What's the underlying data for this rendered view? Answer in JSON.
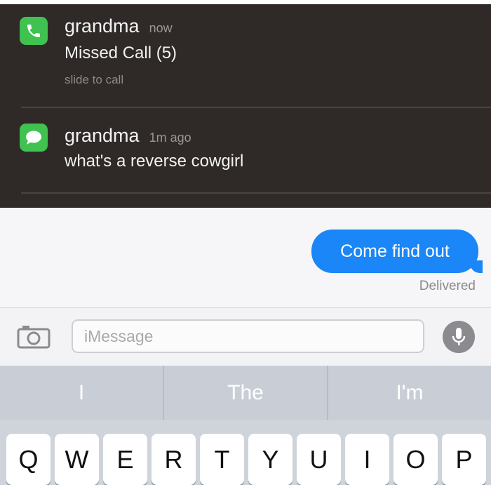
{
  "notifications": [
    {
      "icon": "phone-icon",
      "title": "grandma",
      "time": "now",
      "body": "Missed Call (5)",
      "sub": "slide to call"
    },
    {
      "icon": "message-icon",
      "title": "grandma",
      "time": "1m ago",
      "body": "what's a reverse cowgirl"
    }
  ],
  "conversation": {
    "outgoing_message": "Come find out",
    "status": "Delivered"
  },
  "input_bar": {
    "placeholder": "iMessage",
    "camera_icon": "camera-icon",
    "mic_icon": "microphone-icon"
  },
  "predictive": [
    "I",
    "The",
    "I'm"
  ],
  "keyboard": {
    "row1": [
      "Q",
      "W",
      "E",
      "R",
      "T",
      "Y",
      "U",
      "I",
      "O",
      "P"
    ]
  },
  "colors": {
    "notification_bg": "#2f2a28",
    "app_green": "#3fc24f",
    "bubble_blue": "#1a86f7",
    "keyboard_bg": "#cfd3da"
  }
}
